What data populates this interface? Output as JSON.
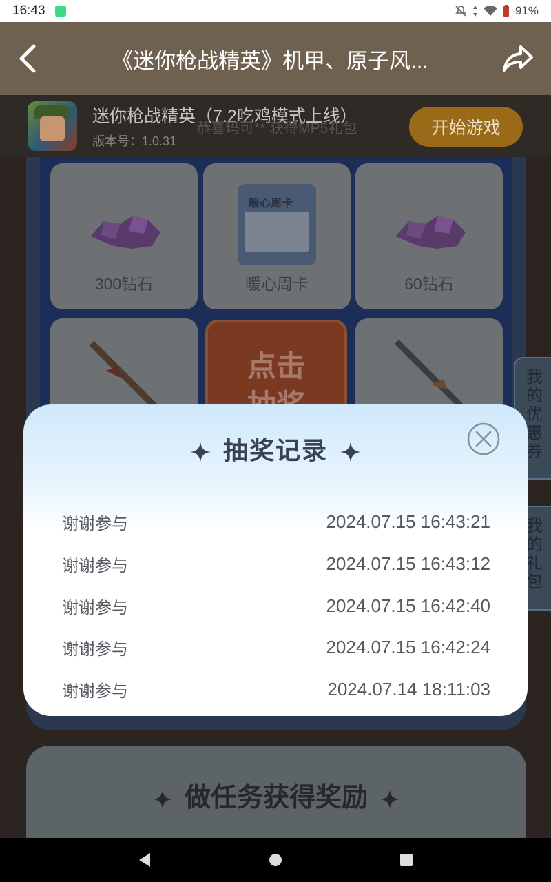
{
  "status_bar": {
    "time": "16:43",
    "battery": "91%"
  },
  "header": {
    "title": "《迷你枪战精英》机甲、原子风..."
  },
  "game": {
    "name": "迷你枪战精英（7.2吃鸡模式上线）",
    "version": "版本号：1.0.31",
    "start_label": "开始游戏",
    "banner_ghost": "恭喜玛可** 获得MP5礼包"
  },
  "prizes": [
    {
      "label": "300钻石",
      "icon": "purple-gem-icon"
    },
    {
      "label": "暖心周卡",
      "icon": "weekly-card-icon",
      "card_title": "暖心周卡"
    },
    {
      "label": "60钻石",
      "icon": "purple-gem-icon"
    }
  ],
  "draw_button": {
    "line1": "点击",
    "line2": "抽奖"
  },
  "side_tabs": {
    "coupons": "我的优惠券",
    "gifts": "我的礼包"
  },
  "task_section": {
    "title": "做任务获得奖励"
  },
  "modal": {
    "title": "抽奖记录",
    "records": [
      {
        "result": "谢谢参与",
        "time": "2024.07.15 16:43:21"
      },
      {
        "result": "谢谢参与",
        "time": "2024.07.15 16:43:12"
      },
      {
        "result": "谢谢参与",
        "time": "2024.07.15 16:42:40"
      },
      {
        "result": "谢谢参与",
        "time": "2024.07.15 16:42:24"
      },
      {
        "result": "谢谢参与",
        "time": "2024.07.14 18:11:03"
      }
    ]
  },
  "colors": {
    "header": "#6e6150",
    "start_button": "#9a6a18",
    "modal_top": "#cfe9fb",
    "text": "#555a61"
  }
}
